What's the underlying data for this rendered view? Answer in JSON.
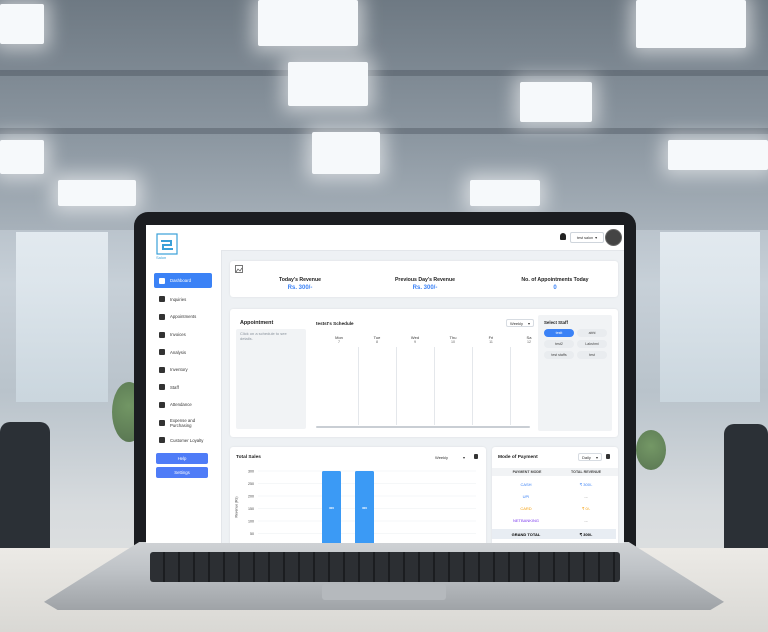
{
  "brand": {
    "name": "Salon"
  },
  "topbar": {
    "user_label": "test salon",
    "dropdown_glyph": "▾"
  },
  "sidebar": {
    "items": [
      {
        "label": "Dashboard",
        "icon": "grid-icon",
        "active": true
      },
      {
        "label": "Inquiries",
        "icon": "document-icon"
      },
      {
        "label": "Appointments",
        "icon": "file-icon"
      },
      {
        "label": "Invoices",
        "icon": "invoice-icon"
      },
      {
        "label": "Analysis",
        "icon": "chart-line-icon"
      },
      {
        "label": "Inventory",
        "icon": "box-icon"
      },
      {
        "label": "Staff",
        "icon": "people-icon"
      },
      {
        "label": "Attendance",
        "icon": "calendar-icon"
      },
      {
        "label": "Expense and Purchasing",
        "icon": "cart-icon"
      },
      {
        "label": "Customer Loyalty",
        "icon": "gift-icon"
      }
    ],
    "help_label": "Help",
    "settings_label": "Settings"
  },
  "stats": [
    {
      "label": "Today's Revenue",
      "value": "Rs. 300/-"
    },
    {
      "label": "Previous Day's Revenue",
      "value": "Rs. 300/-"
    },
    {
      "label": "No. of Appointments Today",
      "value": "0"
    }
  ],
  "appointment": {
    "title": "Appointment",
    "hint": "Click on a schedule to see details."
  },
  "schedule": {
    "title": "testst's Schedule",
    "period": "Weekly",
    "days": [
      {
        "name": "Mon",
        "num": "7"
      },
      {
        "name": "Tue",
        "num": "8"
      },
      {
        "name": "Wed",
        "num": "9"
      },
      {
        "name": "Thu",
        "num": "10"
      },
      {
        "name": "Fri",
        "num": "11"
      },
      {
        "name": "Sa",
        "num": "12"
      }
    ]
  },
  "staff": {
    "title": "Select Staff",
    "members": [
      "testt",
      "abhi",
      "test2",
      "Lakshmi",
      "test staffs",
      "test"
    ],
    "selected": "testt"
  },
  "total_sales": {
    "title": "Total Sales",
    "period": "Weekly",
    "ylabel": "Revenue (Rs)",
    "y_ticks": [
      "300",
      "250",
      "200",
      "150",
      "100",
      "50"
    ],
    "bar_labels": [
      "300",
      "300"
    ]
  },
  "payment": {
    "title": "Mode of Payment",
    "period": "Daily",
    "head_mode": "PAYMENT MODE",
    "head_revenue": "TOTAL REVENUE",
    "rows": [
      {
        "mode": "CASH",
        "value": "₹ 300/-",
        "color": "#3b82f6"
      },
      {
        "mode": "UPI",
        "value": "...",
        "color": "#3b82f6"
      },
      {
        "mode": "CARD",
        "value": "₹ 0/-",
        "color": "#f59e0b"
      },
      {
        "mode": "NETBANKING",
        "value": "...",
        "color": "#7c3aed"
      }
    ],
    "grand_label": "GRAND TOTAL",
    "grand_value": "₹ 300/-"
  },
  "colors": {
    "accent": "#3b82f6",
    "sidebar_button": "#4f7cf7",
    "bar": "#3b9af5"
  }
}
